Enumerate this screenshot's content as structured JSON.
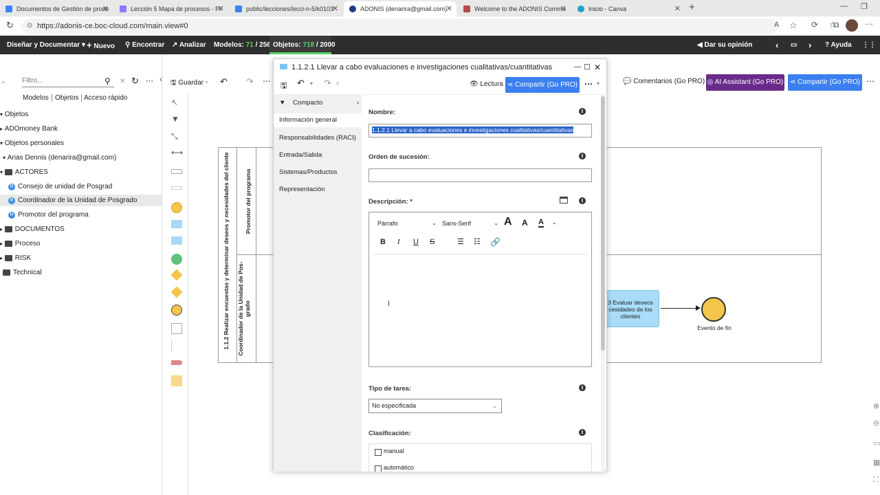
{
  "browser": {
    "tabs": [
      {
        "label": "Documentos de Gestión de proce",
        "color": "#3b82f6"
      },
      {
        "label": "Lección 5 Mapa de procesos - Pr",
        "color": "#8b7cf6"
      },
      {
        "label": "public/lecciones/lecci-n-5/k0103",
        "color": "#3b82f6"
      },
      {
        "label": "ADONIS (denarira@gmail.com)",
        "color": "#1e3a8a",
        "active": true
      },
      {
        "label": "Welcome to the ADONIS Commu",
        "color": "#b04a4a"
      },
      {
        "label": "Inicio - Canva",
        "color": "#20a4c8"
      }
    ],
    "url": "https://adonis-ce.boc-cloud.com/main.view#0"
  },
  "app_toolbar": {
    "disenar": "Diseñar y Documentar",
    "nuevo": "Nuevo",
    "encontrar": "Encontrar",
    "analizar": "Analizar",
    "modelos_label": "Modelos:",
    "modelos_count": "71",
    "modelos_total": "/ 256",
    "objetos_label": "Objetos:",
    "objetos_count": "718",
    "objetos_total": "/ 2000",
    "opinion": "Dar su opinión",
    "ayuda": "Ayuda"
  },
  "left_panel": {
    "filter_placeholder": "Filtro...",
    "tabs": [
      "Modelos",
      "Objetos",
      "Acceso rápido"
    ],
    "tree": [
      {
        "label": "Objetos",
        "type": "root"
      },
      {
        "label": "ADOmoney Bank",
        "type": "root"
      },
      {
        "label": "Objetos personales",
        "type": "root"
      },
      {
        "label": "Arias Dennis (denarira@gmail.com)",
        "type": "user"
      },
      {
        "label": "ACTORES",
        "type": "folder"
      },
      {
        "label": "Consejo de unidad de Posgrad",
        "type": "role"
      },
      {
        "label": "Coordinador de la Unidad de Posgrado",
        "type": "role",
        "selected": true
      },
      {
        "label": "Promotor del programa",
        "type": "role"
      },
      {
        "label": "DOCUMENTOS",
        "type": "folder"
      },
      {
        "label": "Proceso",
        "type": "folder"
      },
      {
        "label": "RISK",
        "type": "folder"
      },
      {
        "label": "Technical",
        "type": "folder"
      }
    ]
  },
  "editor_bar": {
    "guardar": "Guardar",
    "comentarios": "Comentarios (Go PRO)",
    "ai_assistant": "AI Assistant (Go PRO)",
    "compartir": "Compartir (Go PRO)"
  },
  "diagram": {
    "pool_label": "1.1.2 Realizar encuestas y determinar deseos y necesidades del cliente",
    "lane1": "Promotor del programa",
    "lane2": "Coordinador de la Unidad de Pos-grado",
    "task_label": "3 Evaluar deseos\ncesidades de los\nclientes",
    "end_event": "Evento de fin"
  },
  "dialog": {
    "title": "1.1.2.1  Llevar a cabo evaluaciones e investigaciones  cualitativas/cuantitativas",
    "lectura": "Lectura",
    "compartir": "Compartir (Go PRO)",
    "nav": {
      "compacto": "Compacto",
      "items": [
        "Información general",
        "Responsabilidades (RACI)",
        "Entrada/Salida",
        "Sistemas/Productos",
        "Representación"
      ]
    },
    "fields": {
      "nombre_label": "Nombre:",
      "nombre_value": "1.1.2.1  Llevar a cabo evaluaciones e investigaciones  cualitativas/cuantitativas",
      "orden_label": "Orden de sucesión:",
      "orden_value": "",
      "descripcion_label": "Descripción:",
      "required_mark": "*",
      "editor_paragraph": "Párrafo",
      "editor_font": "Sans-Serif",
      "tipo_label": "Tipo de tarea:",
      "tipo_value": "No especificada",
      "clasificacion_label": "Clasificación:",
      "clasificacion_options": [
        "manual",
        "automático"
      ]
    }
  }
}
